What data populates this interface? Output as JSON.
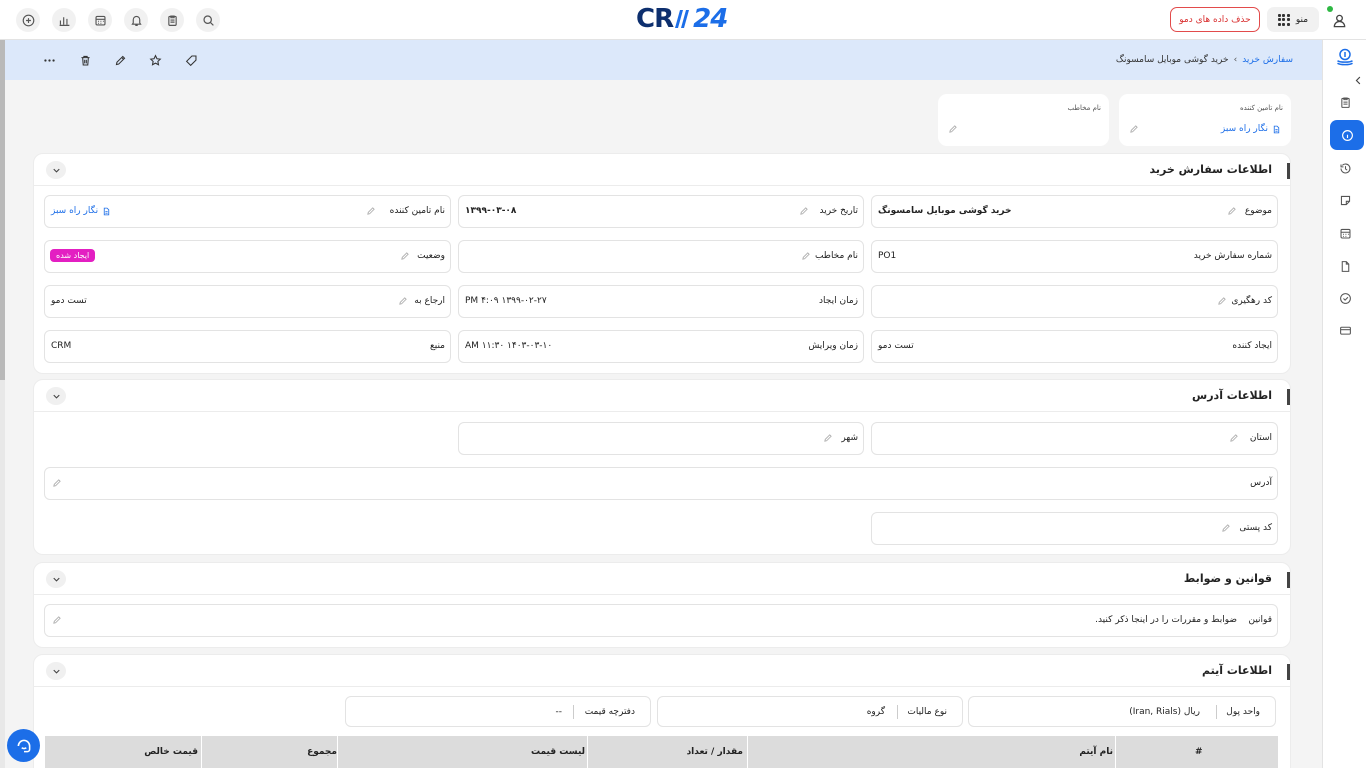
{
  "header": {
    "logo_left": "CR",
    "logo_right": "24",
    "demo_button": "حذف داده های دمو",
    "menu_label": "منو"
  },
  "breadcrumb": {
    "parent": "سفارش خرید",
    "separator": "›",
    "current": "خرید گوشی موبایل سامسونگ"
  },
  "summary": {
    "supplier_label": "نام تامین کننده",
    "supplier_value": "نگار راه سبز",
    "contact_label": "نام مخاطب",
    "contact_value": ""
  },
  "order_section": {
    "title": "اطلاعات سفارش خرید",
    "subject_label": "موضوع",
    "subject_value": "خرید گوشی موبایل سامسونگ",
    "purchase_date_label": "تاریخ خرید",
    "purchase_date_value": "۱۳۹۹-۰۳-۰۸",
    "supplier_label": "نام تامین کننده",
    "supplier_value": "نگار راه سبز",
    "order_number_label": "شماره سفارش خرید",
    "order_number_value": "PO1",
    "contact_label": "نام مخاطب",
    "contact_value": "",
    "status_label": "وضعیت",
    "status_value": "ایجاد شده",
    "tracking_label": "کد رهگیری",
    "tracking_value": "",
    "created_time_label": "زمان ایجاد",
    "created_time_value": "۱۳۹۹-۰۲-۲۷ ۴:۰۹ PM",
    "assigned_label": "ارجاع به",
    "assigned_value": "تست دمو",
    "creator_label": "ایجاد کننده",
    "creator_value": "تست دمو",
    "modified_time_label": "زمان ویرایش",
    "modified_time_value": "۱۴۰۳-۰۳-۱۰ ۱۱:۳۰ AM",
    "source_label": "منبع",
    "source_value": "CRM"
  },
  "address_section": {
    "title": "اطلاعات آدرس",
    "province_label": "استان",
    "city_label": "شهر",
    "address_label": "آدرس",
    "postal_label": "کد پستی"
  },
  "terms_section": {
    "title": "قوانین و ضوابط",
    "terms_label": "قوانین",
    "terms_value": "ضوابط و مقررات را در اینجا ذکر کنید."
  },
  "items_section": {
    "title": "اطلاعات آیتم",
    "currency_label": "واحد پول",
    "currency_value": "(Iran, Rials) ریال",
    "tax_label": "نوع مالیات",
    "tax_value": "گروه",
    "pricebook_label": "دفترچه قیمت",
    "pricebook_value": "--",
    "columns": [
      "#",
      "نام آیتم",
      "مقدار / تعداد",
      "لیست قیمت",
      "مجموع",
      "قیمت خالص"
    ]
  }
}
